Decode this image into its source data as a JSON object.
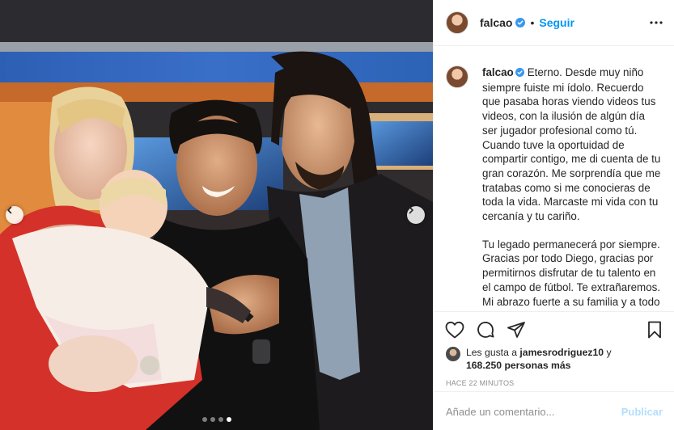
{
  "post": {
    "carousel": {
      "prev_icon": "chevron-left-icon",
      "next_icon": "chevron-right-icon",
      "slides": 4,
      "active_slide": 4
    }
  },
  "header": {
    "username": "falcao",
    "verified_icon": "verified-badge-icon",
    "separator": "•",
    "follow_label": "Seguir",
    "more_icon": "more-options-icon"
  },
  "caption": {
    "username": "falcao",
    "paragraphs": [
      "Eterno. Desde muy niño siempre fuiste mi ídolo. Recuerdo que pasaba horas viendo videos tus videos, con la ilusión de algún día ser jugador profesional como tú. Cuando tuve la oportuidad de compartir contigo, me di cuenta de tu gran corazón. Me sorprendía que me tratabas como si me conocieras de toda la vida. Marcaste mi vida con tu cercanía y tu cariño.",
      "Tu legado permanecerá por siempre. Gracias por todo Diego, gracias por permitirnos disfrutar de tu talento en el campo de fútbol. Te extrañaremos. Mi abrazo fuerte a su familia y a todo el pueblo argentino en estos momentos"
    ]
  },
  "actions": {
    "like_icon": "heart-icon",
    "comment_icon": "comment-icon",
    "share_icon": "share-icon",
    "save_icon": "bookmark-icon"
  },
  "likes": {
    "prefix": "Les gusta a",
    "user": "jamesrodriguez10",
    "connector": "y",
    "count": "168.250 personas más"
  },
  "timestamp": "HACE 22 MINUTOS",
  "comment_box": {
    "placeholder": "Añade un comentario...",
    "publish_label": "Publicar"
  },
  "colors": {
    "accent": "#0095f6",
    "publish_disabled": "#b2dffc",
    "muted": "#8e8e8e",
    "text": "#262626",
    "border": "#efefef"
  }
}
